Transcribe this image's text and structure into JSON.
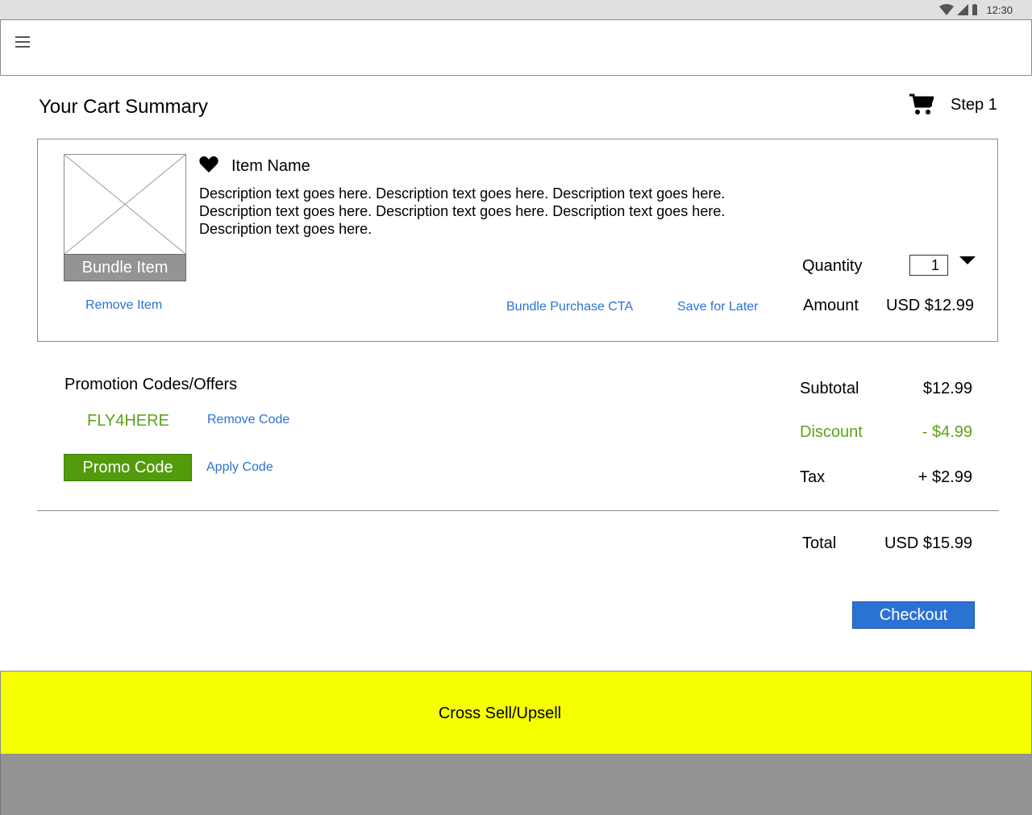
{
  "status_bar": {
    "time": "12:30",
    "icons": [
      "wifi-icon",
      "cell-signal-icon",
      "battery-icon"
    ]
  },
  "app_bar": {
    "menu_icon": "menu-icon"
  },
  "header": {
    "title": "Your Cart Summary",
    "cart_icon": "cart-icon",
    "step": "Step 1"
  },
  "item": {
    "image_placeholder": "image-placeholder",
    "badge": "Bundle Item",
    "favorite_icon": "heart-icon",
    "name": "Item Name",
    "description": "Description text goes here. Description text goes here. Description text goes here. Description text goes here. Description text goes here. Description text goes here. Description text goes here.",
    "remove_label": "Remove Item",
    "bundle_cta_label": "Bundle Purchase CTA",
    "save_later_label": "Save for Later",
    "quantity_label": "Quantity",
    "quantity_value": "1",
    "amount_label": "Amount",
    "amount_value": "USD $12.99"
  },
  "promo": {
    "title": "Promotion Codes/Offers",
    "applied_code": "FLY4HERE",
    "remove_code_label": "Remove Code",
    "promo_button_label": "Promo Code",
    "apply_code_label": "Apply Code"
  },
  "summary": {
    "subtotal_label": "Subtotal",
    "subtotal_value": "$12.99",
    "discount_label": "Discount",
    "discount_value": "- $4.99",
    "tax_label": "Tax",
    "tax_value": "+ $2.99",
    "total_label": "Total",
    "total_value": "USD $15.99"
  },
  "checkout_label": "Checkout",
  "cross_sell_label": "Cross Sell/Upsell",
  "colors": {
    "link": "#2b73d3",
    "promo_green": "#539b0b",
    "discount_green": "#5da21c",
    "checkout_blue": "#2b73d3",
    "cross_sell_yellow": "#f5ff00",
    "footer_gray": "#949494"
  }
}
